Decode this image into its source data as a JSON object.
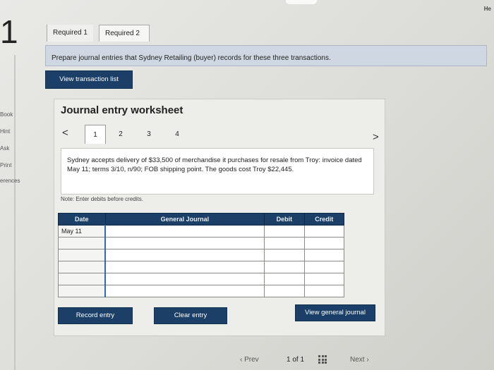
{
  "header": {
    "help_text": "He",
    "question_number": "1"
  },
  "sidebar": {
    "items": [
      {
        "label": "Book"
      },
      {
        "label": "Hint"
      },
      {
        "label": "Ask"
      },
      {
        "label": "Print"
      },
      {
        "label": "erences"
      }
    ]
  },
  "tabs": [
    {
      "label": "Required 1"
    },
    {
      "label": "Required 2"
    }
  ],
  "banner": {
    "text": "Prepare journal entries that Sydney Retailing (buyer) records for these three transactions."
  },
  "buttons": {
    "view_transaction_list": "View transaction list",
    "record_entry": "Record entry",
    "clear_entry": "Clear entry",
    "view_general_journal": "View general journal"
  },
  "worksheet": {
    "title": "Journal entry worksheet",
    "prev_arrow": "<",
    "next_arrow": ">",
    "pages": [
      "1",
      "2",
      "3",
      "4"
    ],
    "active_page": 1,
    "description": "Sydney accepts delivery of $33,500 of merchandise it purchases for resale from Troy: invoice dated May 11; terms 3/10, n/90; FOB shipping point. The goods cost Troy $22,445.",
    "note": "Note: Enter debits before credits."
  },
  "journal": {
    "columns": [
      "Date",
      "General Journal",
      "Debit",
      "Credit"
    ],
    "rows": [
      {
        "date": "May 11",
        "account": "",
        "debit": "",
        "credit": ""
      },
      {
        "date": "",
        "account": "",
        "debit": "",
        "credit": ""
      },
      {
        "date": "",
        "account": "",
        "debit": "",
        "credit": ""
      },
      {
        "date": "",
        "account": "",
        "debit": "",
        "credit": ""
      },
      {
        "date": "",
        "account": "",
        "debit": "",
        "credit": ""
      },
      {
        "date": "",
        "account": "",
        "debit": "",
        "credit": ""
      }
    ]
  },
  "pagination": {
    "prev_label": "Prev",
    "page_info": "1 of 1",
    "next_label": "Next"
  },
  "colors": {
    "primary_button": "#1b3f66",
    "banner": "#cfd8e2",
    "active_cell_marker": "#2f6db0"
  }
}
